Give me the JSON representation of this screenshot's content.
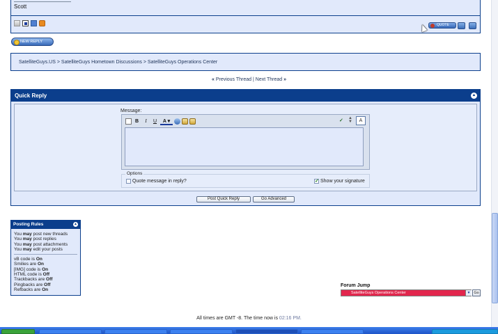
{
  "post": {
    "author_signature": "Scott",
    "quote_button_label": "QUOTE"
  },
  "new_reply_label": "NEW REPLY",
  "breadcrumb": {
    "items": [
      "SatelliteGuys.US",
      "SatelliteGuys Hometown Discussions",
      "SatelliteGuys Operations Center"
    ],
    "separator": ">"
  },
  "thread_nav": {
    "prev": "Previous Thread",
    "divider": "|",
    "next": "Next Thread",
    "left_arrow": "«",
    "right_arrow": "»"
  },
  "quick_reply": {
    "title": "Quick Reply",
    "message_label": "Message:",
    "toolbar": {
      "bold": "B",
      "italic": "I",
      "underline": "U",
      "font_color": "A"
    },
    "options_legend": "Options",
    "quote_option": "Quote message in reply?",
    "quote_checked": false,
    "signature_option": "Show your signature",
    "signature_checked": true,
    "post_button": "Post Quick Reply",
    "advanced_button": "Go Advanced"
  },
  "posting_rules": {
    "title": "Posting Rules",
    "permissions": [
      {
        "pre": "You",
        "bold": "may",
        "post": "post new threads"
      },
      {
        "pre": "You",
        "bold": "may",
        "post": "post replies"
      },
      {
        "pre": "You",
        "bold": "may",
        "post": "post attachments"
      },
      {
        "pre": "You",
        "bold": "may",
        "post": "edit your posts"
      }
    ],
    "codes": [
      {
        "pre": "vB code is",
        "bold": "On"
      },
      {
        "pre": "Smilies are",
        "bold": "On"
      },
      {
        "pre": "[IMG] code is",
        "bold": "On"
      },
      {
        "pre": "HTML code is",
        "bold": "Off"
      },
      {
        "pre": "Trackbacks are",
        "bold": "Off"
      },
      {
        "pre": "Pingbacks are",
        "bold": "Off"
      },
      {
        "pre": "Refbacks are",
        "bold": "On"
      }
    ]
  },
  "forum_jump": {
    "label": "Forum Jump",
    "selected": "SatelliteGuys Operations Center",
    "go_label": "Go"
  },
  "footer": {
    "time_prefix": "All times are GMT -8. The time now is",
    "time": "02:16",
    "time_suffix": "PM."
  },
  "colors": {
    "header_blue": "#0b3e8c",
    "panel_bg": "#e1e9fb",
    "forum_jump_selected": "#e2264d"
  }
}
